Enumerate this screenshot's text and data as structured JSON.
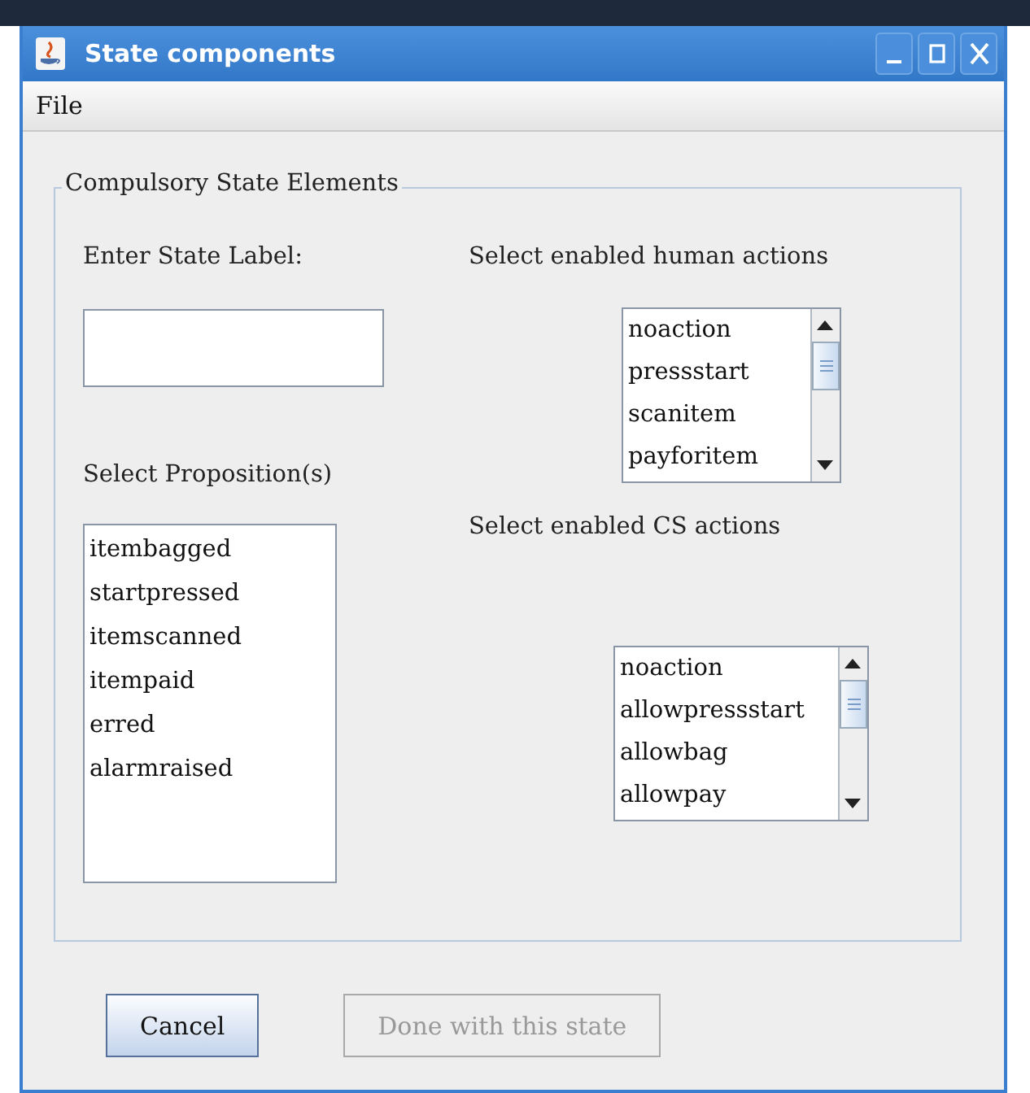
{
  "window": {
    "title": "State components"
  },
  "menu": [
    "File"
  ],
  "group": {
    "title": "Compulsory State Elements",
    "state_label": {
      "label": "Enter State Label:"
    },
    "propositions": {
      "label": "Select Proposition(s)",
      "items": [
        "itembagged",
        "startpressed",
        "itemscanned",
        "itempaid",
        "erred",
        "alarmraised"
      ]
    },
    "human_actions": {
      "label": "Select enabled human actions",
      "items": [
        "noaction",
        "pressstart",
        "scanitem",
        "payforitem"
      ]
    },
    "cs_actions": {
      "label": "Select enabled CS actions",
      "items": [
        "noaction",
        "allowpressstart",
        "allowbag",
        "allowpay"
      ]
    }
  },
  "buttons": [
    {
      "label": "Cancel",
      "disabled": false
    },
    {
      "label": "Done with this state",
      "disabled": true
    }
  ]
}
